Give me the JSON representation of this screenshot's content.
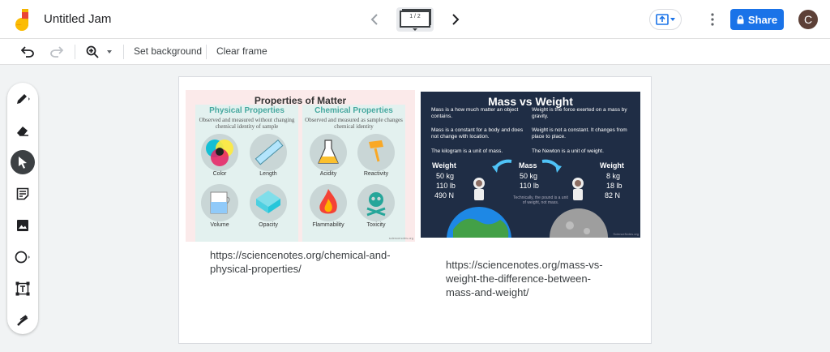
{
  "header": {
    "title": "Untitled Jam",
    "frame_counter": "1 / 2",
    "share_label": "Share",
    "avatar_initial": "C"
  },
  "toolbar": {
    "set_background": "Set background",
    "clear_frame": "Clear frame"
  },
  "tools": [
    "pen-icon",
    "eraser-icon",
    "select-icon",
    "sticky-note-icon",
    "image-icon",
    "circle-icon",
    "text-box-icon",
    "laser-icon"
  ],
  "colors": {
    "accent": "#1a73e8",
    "avatar": "#5d4037",
    "active_tool": "#3c4043"
  },
  "image1": {
    "title": "Properties of Matter",
    "physical_heading": "Physical Properties",
    "physical_desc": "Observed and measured without changing chemical identity of sample",
    "chemical_heading": "Chemical Properties",
    "chemical_desc": "Observed and measured as sample changes chemical identity",
    "labels": [
      "Color",
      "Length",
      "Acidity",
      "Reactivity",
      "Volume",
      "Opacity",
      "Flammability",
      "Toxicity"
    ],
    "credit": "sciencenotes.org"
  },
  "image2": {
    "title": "Mass vs Weight",
    "mass_def": "Mass is a how much matter an object contains.",
    "weight_def": "Weight is the force exerted on a mass by gravity.",
    "mass_const": "Mass is a constant for a body and does not change with location.",
    "weight_const": "Weight is not a constant. It changes from place to place.",
    "kg_unit": "The kilogram is a unit of mass.",
    "newton_unit": "The Newton is a unit of weight.",
    "left_header": "Weight",
    "left_values": [
      "50 kg",
      "110 lb",
      "490 N"
    ],
    "mid_header": "Mass",
    "mid_values": [
      "50 kg",
      "110 lb"
    ],
    "right_header": "Weight",
    "right_values": [
      "8 kg",
      "18 lb",
      "82 N"
    ],
    "note": "Technically, the pound is a unit of weight, not mass.",
    "credit": "ScienceNotes.org"
  },
  "links": {
    "link1": "https://sciencenotes.org/chemical-and-physical-properties/",
    "link2": "https://sciencenotes.org/mass-vs-weight-the-difference-between-mass-and-weight/"
  }
}
